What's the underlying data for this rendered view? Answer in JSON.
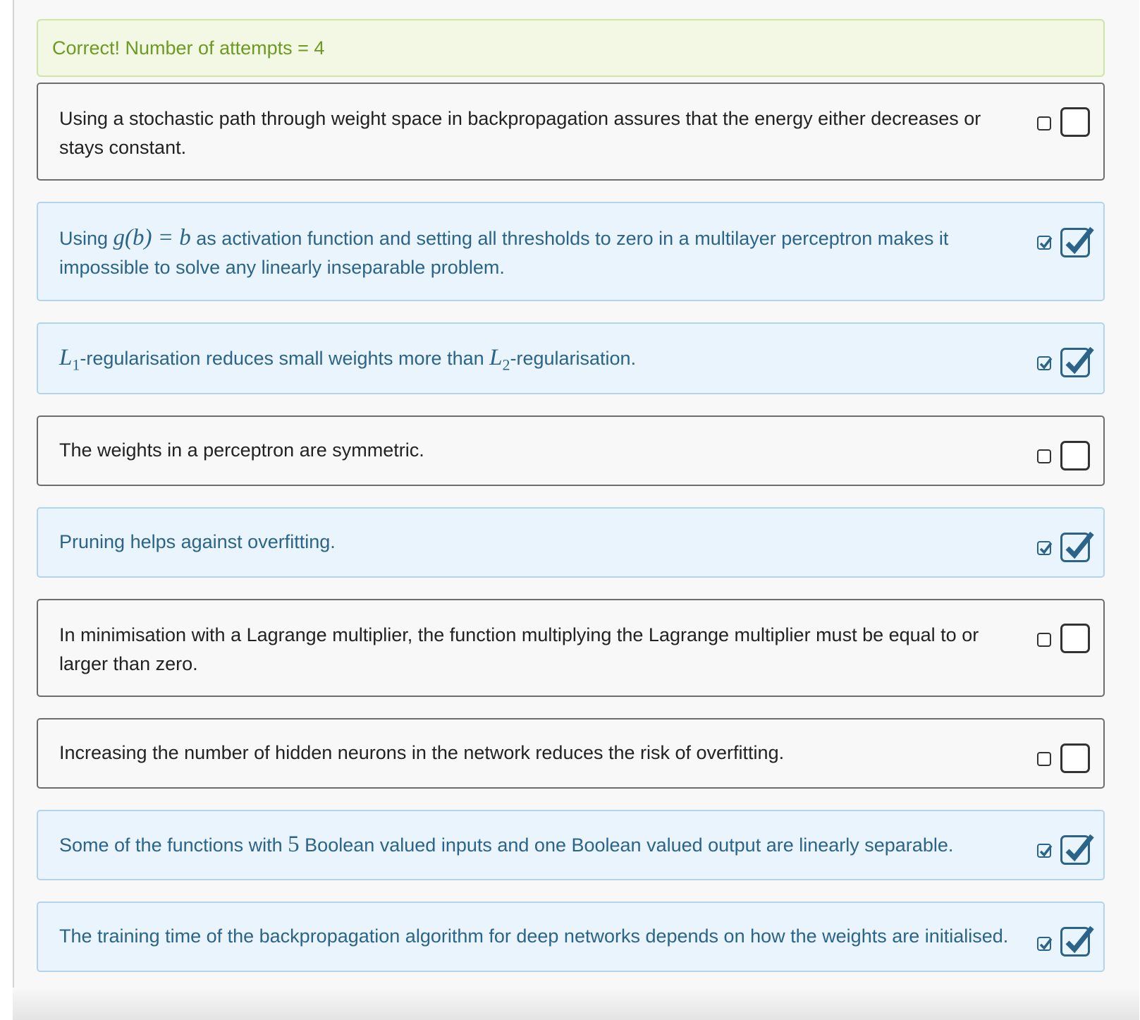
{
  "feedback": {
    "text": "Correct! Number of attempts = 4",
    "color": "#6e9a23",
    "background": "#f2f8e3"
  },
  "options": [
    {
      "text": "Using a stochastic path through weight space in backpropagation assures that the energy either decreases or stays constant.",
      "checked": false
    },
    {
      "text_before": "Using ",
      "math": "g(b) = b",
      "text_after": " as activation function and setting all thresholds to zero in a multilayer perceptron makes it impossible to solve any linearly inseparable problem.",
      "checked": true
    },
    {
      "math1": "L",
      "sub1": "1",
      "text_middle": "-regularisation reduces small weights more than ",
      "math2": "L",
      "sub2": "2",
      "text_after": "-regularisation.",
      "checked": true
    },
    {
      "text": "The weights in a perceptron are symmetric.",
      "checked": false
    },
    {
      "text": "Pruning helps against overfitting.",
      "checked": true
    },
    {
      "text": "In minimisation with a Lagrange multiplier, the function multiplying the Lagrange multiplier must be equal to or larger than zero.",
      "checked": false
    },
    {
      "text": "Increasing the number of hidden neurons in the network reduces the risk of overfitting.",
      "checked": false
    },
    {
      "text_before": "Some of the functions with ",
      "math": "5",
      "text_after": " Boolean valued inputs and one Boolean valued output are linearly separable.",
      "checked": true
    },
    {
      "text": "The training time of the backpropagation algorithm for deep networks depends on how the weights are initialised.",
      "checked": true
    }
  ],
  "colors": {
    "checked_text": "#2b6488",
    "checked_bg": "#e9f4fc",
    "checked_border": "#b2d5ee",
    "unchecked_text": "#222222",
    "unchecked_border": "#6d6d6d"
  },
  "icons": {
    "checked": "checkbox-checked-icon",
    "unchecked": "checkbox-empty-icon"
  }
}
